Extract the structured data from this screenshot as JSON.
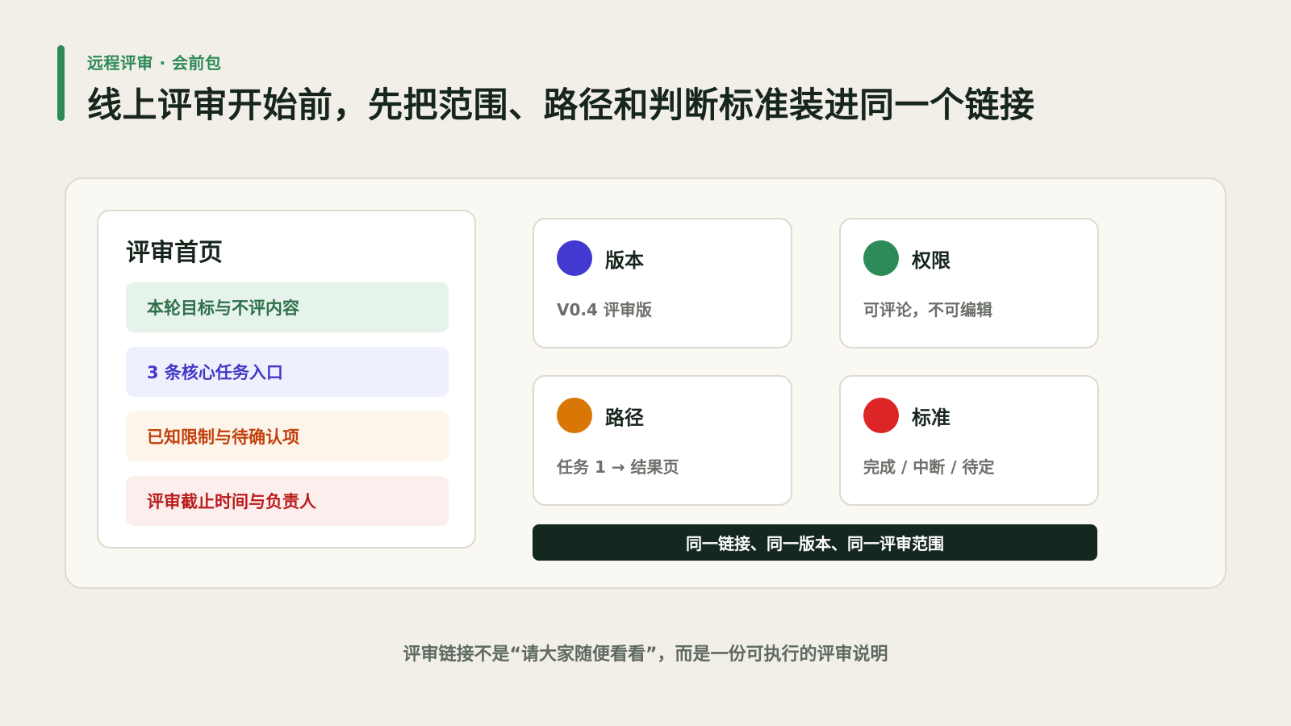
{
  "header": {
    "eyebrow": "远程评审 · 会前包",
    "title": "线上评审开始前，先把范围、路径和判断标准装进同一个链接"
  },
  "home_card": {
    "title": "评审首页",
    "items": [
      {
        "label": "本轮目标与不评内容",
        "text_color": "#2f6f4b",
        "bg_color": "#e6f3ea"
      },
      {
        "label": "3 条核心任务入口",
        "text_color": "#4338c8",
        "bg_color": "#eef1fd"
      },
      {
        "label": "已知限制与待确认项",
        "text_color": "#c2410c",
        "bg_color": "#fdf4ea"
      },
      {
        "label": "评审截止时间与负责人",
        "text_color": "#b91c1c",
        "bg_color": "#fdeeee"
      }
    ]
  },
  "info_cards": [
    {
      "title": "版本",
      "value": "V0.4 评审版",
      "dot_color": "#4338d0",
      "icon": "blue-dot-icon"
    },
    {
      "title": "权限",
      "value": "可评论，不可编辑",
      "dot_color": "#2e8a59",
      "icon": "green-dot-icon"
    },
    {
      "title": "路径",
      "value": "任务 1 → 结果页",
      "dot_color": "#d97706",
      "icon": "orange-dot-icon"
    },
    {
      "title": "标准",
      "value": "完成 / 中断 / 待定",
      "dot_color": "#dc2626",
      "icon": "red-dot-icon"
    }
  ],
  "banner": {
    "text": "同一链接、同一版本、同一评审范围"
  },
  "footer": {
    "note": "评审链接不是“请大家随便看看”，而是一份可执行的评审说明"
  },
  "colors": {
    "accent": "#2e8a59",
    "background": "#f2efe8",
    "panel": "#faf8f3",
    "dark": "#15281f"
  }
}
